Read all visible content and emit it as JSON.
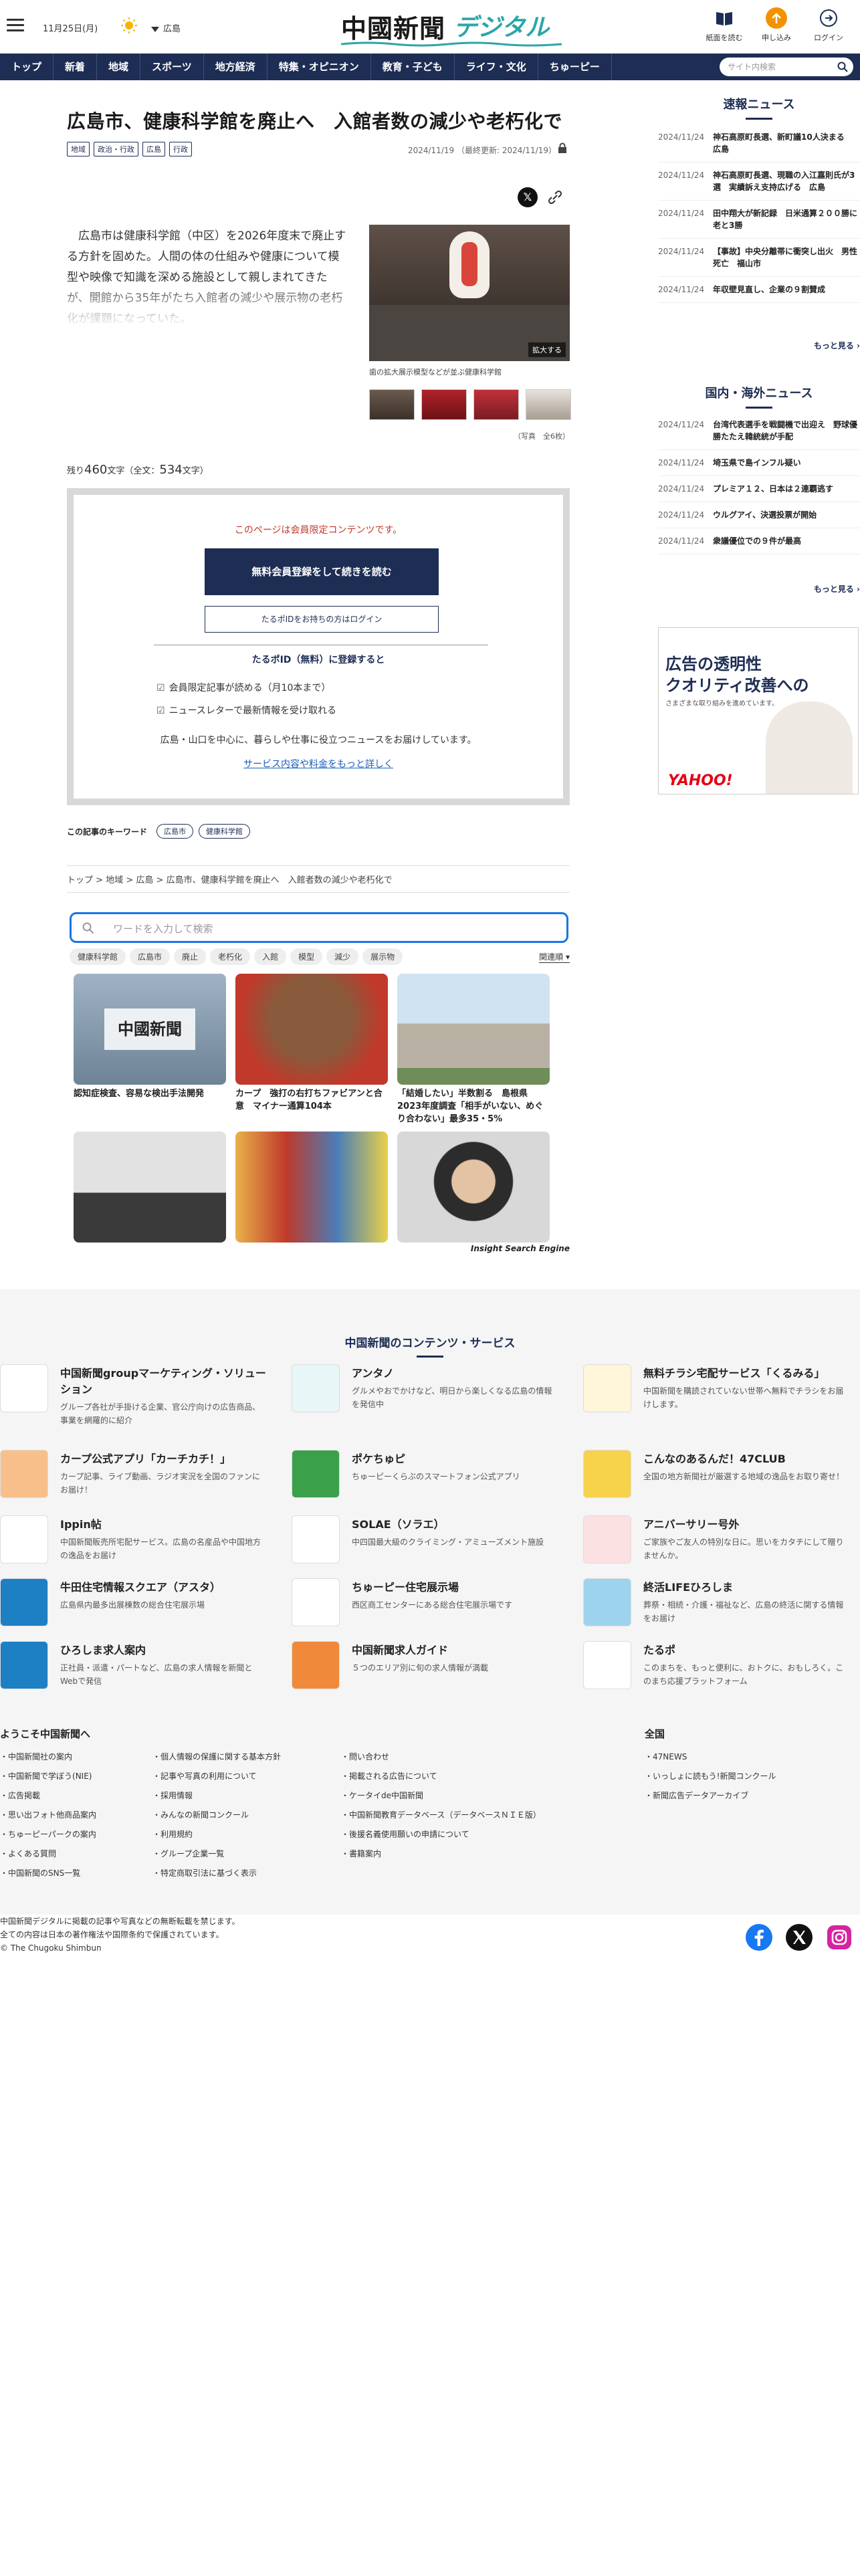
{
  "header": {
    "date": "11月25日(月)",
    "weather_icon": "sun-icon",
    "region": "広島",
    "logo_main": "中國新聞",
    "logo_sub": "デジタル",
    "buttons": [
      {
        "label": "紙面を読む",
        "icon": "newspaper-icon"
      },
      {
        "label": "申し込み",
        "icon": "subscribe-icon"
      },
      {
        "label": "ログイン",
        "icon": "login-icon"
      }
    ]
  },
  "nav": {
    "items": [
      "トップ",
      "新着",
      "地域",
      "スポーツ",
      "地方経済",
      "特集・オピニオン",
      "教育・子ども",
      "ライフ・文化",
      "ちゅーピー"
    ],
    "search_placeholder": "サイト内検索"
  },
  "article": {
    "title": "広島市、健康科学館を廃止へ　入館者数の減少や老朽化で",
    "tags": [
      "地域",
      "政治・行政",
      "広島",
      "行政"
    ],
    "date": "2024/11/19",
    "updated": "（最終更新: 2024/11/19）",
    "body": "広島市は健康科学館（中区）を2026年度末で廃止する方針を固めた。人間の体の仕組みや健康について模型や映像で知識を深める施設として親しまれてきたが、開館から35年がたち入館者の減少や展示物の老朽化が課題になっていた。",
    "photo_enlarge": "拡大する",
    "photo_caption": "歯の拡大展示模型などが並ぶ健康科学館",
    "photo_count": "（写真　全6枚）",
    "remaining_prefix": "残り",
    "remaining_count": "460",
    "remaining_mid": "文字（全文：",
    "total_count": "534",
    "remaining_suffix": "文字）"
  },
  "paywall": {
    "lead": "このページは会員限定コンテンツです。",
    "register_button": "無料会員登録をして続きを読む",
    "login_button": "たるポIDをお持ちの方はログイン",
    "benefits_title": "たるポID（無料）に登録すると",
    "benefits": [
      "会員限定記事が読める（月10本まで）",
      "ニュースレターで最新情報を受け取れる"
    ],
    "note": "広島・山口を中心に、暮らしや仕事に役立つニュースをお届けしています。",
    "more_link": "サービス内容や料金をもっと詳しく"
  },
  "keywords": {
    "label": "この記事のキーワード",
    "items": [
      "広島市",
      "健康科学館"
    ]
  },
  "breadcrumb": [
    "トップ",
    "地域",
    "広島",
    "広島市、健康科学館を廃止へ　入館者数の減少や老朽化で"
  ],
  "insight_search": {
    "placeholder": "ワードを入力して検索",
    "chips": [
      "健康科学館",
      "広島市",
      "廃止",
      "老朽化",
      "入館",
      "模型",
      "減少",
      "展示物"
    ],
    "sort": "関連順",
    "cards": [
      {
        "title": "認知症検査、容易な検出手法開発"
      },
      {
        "title": "カープ　強打の右打ちファビアンと合意　マイナー通算104本"
      },
      {
        "title": "「結婚したい」半数割る　島根県2023年度調査「相手がいない、めぐり合わない」最多35・5%"
      },
      {
        "title": ""
      },
      {
        "title": ""
      },
      {
        "title": ""
      }
    ],
    "card_logo": "中國新聞",
    "engine_label": "Insight Search Engine"
  },
  "sidebar": {
    "breaking_title": "速報ニュース",
    "breaking": [
      {
        "date": "2024/11/24",
        "title": "神石高原町長選、新町議10人決まる　広島"
      },
      {
        "date": "2024/11/24",
        "title": "神石高原町長選、現職の入江嘉則氏が3選　実績訴え支持広げる　広島"
      },
      {
        "date": "2024/11/24",
        "title": "田中翔大が新記録　日米通算２００勝に老と3勝"
      },
      {
        "date": "2024/11/24",
        "title": "【事故】中央分離帯に衝突し出火　男性死亡　福山市"
      },
      {
        "date": "2024/11/24",
        "title": "年収壁見直し、企業の９割賛成"
      }
    ],
    "more1": "もっと見る",
    "world_title": "国内・海外ニュース",
    "world": [
      {
        "date": "2024/11/24",
        "title": "台湾代表選手を戦闘機で出迎え　野球優勝たたえ韓統統が手配"
      },
      {
        "date": "2024/11/24",
        "title": "埼玉県で島インフル疑い"
      },
      {
        "date": "2024/11/24",
        "title": "プレミア１２、日本は２連覇逃す"
      },
      {
        "date": "2024/11/24",
        "title": "ウルグアイ、決選投票が開始"
      },
      {
        "date": "2024/11/24",
        "title": "衆議優位での９件が最高"
      }
    ],
    "more2": "もっと見る",
    "ad": {
      "line1": "広告の透明性",
      "line2": "クオリティ改善への",
      "line3": "さまざまな取り組みを進めています。",
      "brand": "YAHOO!"
    }
  },
  "footer": {
    "contents_title": "中国新聞のコンテンツ・サービス",
    "services": [
      {
        "name": "中国新聞groupマーケティング・ソリューション",
        "desc": "グループ各社が手掛ける企業、官公庁向けの広告商品、事業を網羅的に紹介",
        "color": "#ffffff"
      },
      {
        "name": "アンタノ",
        "desc": "グルメやおでかけなど、明日から楽しくなる広島の情報を発信中",
        "color": "#e9f6f8"
      },
      {
        "name": "無料チラシ宅配サービス「くるみる」",
        "desc": "中国新聞を購読されていない世帯へ無料でチラシをお届けします。",
        "color": "#fff6d9"
      },
      {
        "name": "カープ公式アプリ「カーチカチ！」",
        "desc": "カープ記事、ライブ動画、ラジオ実況を全国のファンにお届け！",
        "color": "#f7c08a"
      },
      {
        "name": "ポケちゅピ",
        "desc": "ちゅーピーくらぶのスマートフォン公式アプリ",
        "color": "#3aa04a"
      },
      {
        "name": "こんなのあるんだ！47CLUB",
        "desc": "全国の地方新聞社が厳選する地域の逸品をお取り寄せ！",
        "color": "#f6d34b"
      },
      {
        "name": "Ippin帖",
        "desc": "中国新聞販売所宅配サービス。広島の名産品や中国地方の逸品をお届け",
        "color": "#ffffff"
      },
      {
        "name": "SOLAE（ソラエ）",
        "desc": "中四国最大級のクライミング・アミューズメント施設",
        "color": "#ffffff"
      },
      {
        "name": "アニバーサリー号外",
        "desc": "ご家族やご友人の特別な日に。思いをカタチにして贈りませんか。",
        "color": "#fbe1e1"
      },
      {
        "name": "牛田住宅情報スクエア（アスタ）",
        "desc": "広島県内最多出展棟数の総合住宅展示場",
        "color": "#1d7fc4"
      },
      {
        "name": "ちゅーピー住宅展示場",
        "desc": "西区商工センターにある総合住宅展示場です",
        "color": "#ffffff"
      },
      {
        "name": "終活LIFEひろしま",
        "desc": "葬祭・相続・介護・福祉など、広島の終活に関する情報をお届け",
        "color": "#9ed3ee"
      },
      {
        "name": "ひろしま求人案内",
        "desc": "正社員・派遣・パートなど、広島の求人情報を新聞とWebで発信",
        "color": "#1d7fc4"
      },
      {
        "name": "中国新聞求人ガイド",
        "desc": "５つのエリア別に旬の求人情報が満載",
        "color": "#f08a3a"
      },
      {
        "name": "たるポ",
        "desc": "このまちを、もっと便利に、おトクに、おもしろく。このまち応援プラットフォーム",
        "color": "#ffffff"
      }
    ],
    "welcome_title": "ようこそ中国新聞へ",
    "col1": [
      "中国新聞社の案内",
      "中国新聞で学ぼう(NIE)",
      "広告掲載",
      "思い出フォト他商品案内",
      "ちゅーピーパークの案内",
      "よくある質問",
      "中国新聞のSNS一覧"
    ],
    "col2": [
      "個人情報の保護に関する基本方針",
      "記事や写真の利用について",
      "採用情報",
      "みんなの新聞コンクール",
      "利用規約",
      "グループ企業一覧",
      "特定商取引法に基づく表示"
    ],
    "col3": [
      "問い合わせ",
      "掲載される広告について",
      "ケータイde中国新聞",
      "中国新聞教育データベース（データベースＮＩＥ版）",
      "後援名義使用願いの申請について",
      "書籍案内"
    ],
    "national_title": "全国",
    "col4": [
      "47NEWS",
      "いっしょに読もう!新聞コンクール",
      "新聞広告データアーカイブ"
    ],
    "copyright1": "中国新聞デジタルに掲載の記事や写真などの無断転載を禁じます。",
    "copyright2": "全ての内容は日本の著作権法や国際条約で保護されています。",
    "copyright3": "© The Chugoku Shimbun",
    "social": [
      {
        "icon": "facebook-icon",
        "color": "#1877f2"
      },
      {
        "icon": "x-icon",
        "color": "#111111"
      },
      {
        "icon": "instagram-icon",
        "color": "#d6249f"
      }
    ]
  }
}
